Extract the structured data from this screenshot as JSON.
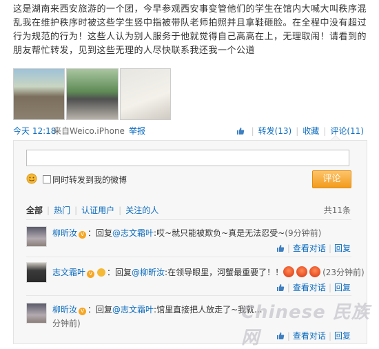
{
  "post": {
    "text": "这是湖南来西安旅游的一个团，今早参观西安事变管他们的学生在馆内大喊大叫秩序混乱我在维护秩序时被这些学生竖中指被带队老师拍照并且拿鞋砸脸。在全程中没有超过行为规范的行为！这些人认为别人服务于他就觉得自己高高在上，无理取闹！请看到的朋友帮忙转发，见到这些无理的人尽快联系我还我一个公道",
    "time": "今天 12:18",
    "from": "来自Weico.iPhone",
    "report": "举报",
    "actions": {
      "forward": "转发(13)",
      "favorite": "收藏",
      "comment": "评论(11)"
    }
  },
  "comment_form": {
    "input_value": "",
    "forward_label": "同时转发到我的微博",
    "submit_label": "评论"
  },
  "filters": {
    "all": "全部",
    "hot": "热门",
    "verified": "认证用户",
    "following": "关注的人",
    "total": "共11条"
  },
  "comments": [
    {
      "name": "柳昕汝",
      "text_pre": "：回复",
      "mention": "@志文霜叶",
      "text": ":哎~就只能被欺负~真是无法忍受~",
      "time": "(9分钟前)",
      "view_conv": "查看对话",
      "reply": "回复"
    },
    {
      "name": "志文霜叶",
      "text_pre": "：回复",
      "mention": "@柳昕汝",
      "text": ":在领导眼里，河蟹最重要了！！",
      "time": "(23分钟前)",
      "view_conv": "查看对话",
      "reply": "回复"
    },
    {
      "name": "柳昕汝",
      "text_pre": "：回复",
      "mention": "@志文霜叶",
      "text": ":馆里直接把人放走了~我就...",
      "time": "分钟前)",
      "view_conv": "查看对话",
      "reply": "回复"
    }
  ],
  "watermark": "Chinese 民族网",
  "colors": {
    "link": "#0a6bbf",
    "button": "#f29b1d",
    "panel_bg": "#f7f7f7"
  }
}
